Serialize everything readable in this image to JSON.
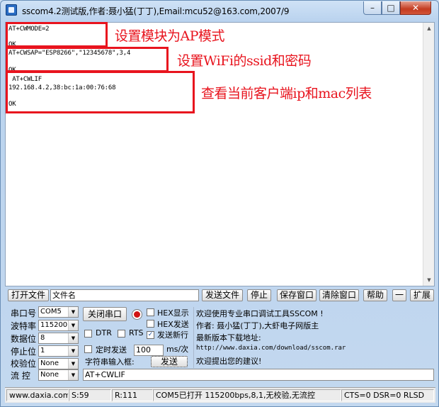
{
  "window": {
    "title": "sscom4.2测试版,作者:聂小猛(丁丁),Email:mcu52@163.com,2007/9"
  },
  "receive": {
    "lines": [
      "AT+CWMODE=2",
      "",
      "OK",
      "AT+CWSAP=\"ESP8266\",\"12345678\",3,4",
      "",
      "OK",
      " AT+CWLIF",
      "192.168.4.2,38:bc:1a:00:76:68",
      "",
      "OK"
    ],
    "annotations": [
      "设置模块为AP模式",
      "设置WiFi的ssid和密码",
      "查看当前客户端ip和mac列表"
    ]
  },
  "file_bar": {
    "open_file": "打开文件",
    "filename_value": "文件名",
    "send_file": "发送文件",
    "stop": "停止",
    "save_window": "保存窗口",
    "clear_window": "清除窗口",
    "help": "帮助",
    "minus": "一",
    "expand": "扩展"
  },
  "serial": {
    "port_label": "串口号",
    "port_value": "COM5",
    "baud_label": "波特率",
    "baud_value": "115200",
    "databits_label": "数据位",
    "databits_value": "8",
    "stopbits_label": "停止位",
    "stopbits_value": "1",
    "parity_label": "校验位",
    "parity_value": "None",
    "flow_label": "流  控",
    "flow_value": "None",
    "close_port": "关闭串口"
  },
  "options": {
    "hex_display": "HEX显示",
    "hex_send": "HEX发送",
    "dtr": "DTR",
    "rts": "RTS",
    "send_newline": "发送新行",
    "timed_send": "定时发送",
    "interval_value": "100",
    "interval_unit": "ms/次",
    "input_label": "字符串输入框:",
    "send_button": "发送",
    "send_value": "AT+CWLIF"
  },
  "info": {
    "line1": "欢迎使用专业串口调试工具SSCOM !",
    "line2": "作者: 聂小猛(丁丁),大虾电子网版主",
    "line3": "最新版本下载地址:",
    "line4": "http://www.daxia.com/download/sscom.rar",
    "line5": "欢迎提出您的建议!"
  },
  "status": {
    "site": "www.daxia.com",
    "sent": "S:59",
    "received": "R:111",
    "port_state": "COM5已打开  115200bps,8,1,无校验,无流控",
    "signals": "CTS=0 DSR=0 RLSD"
  }
}
